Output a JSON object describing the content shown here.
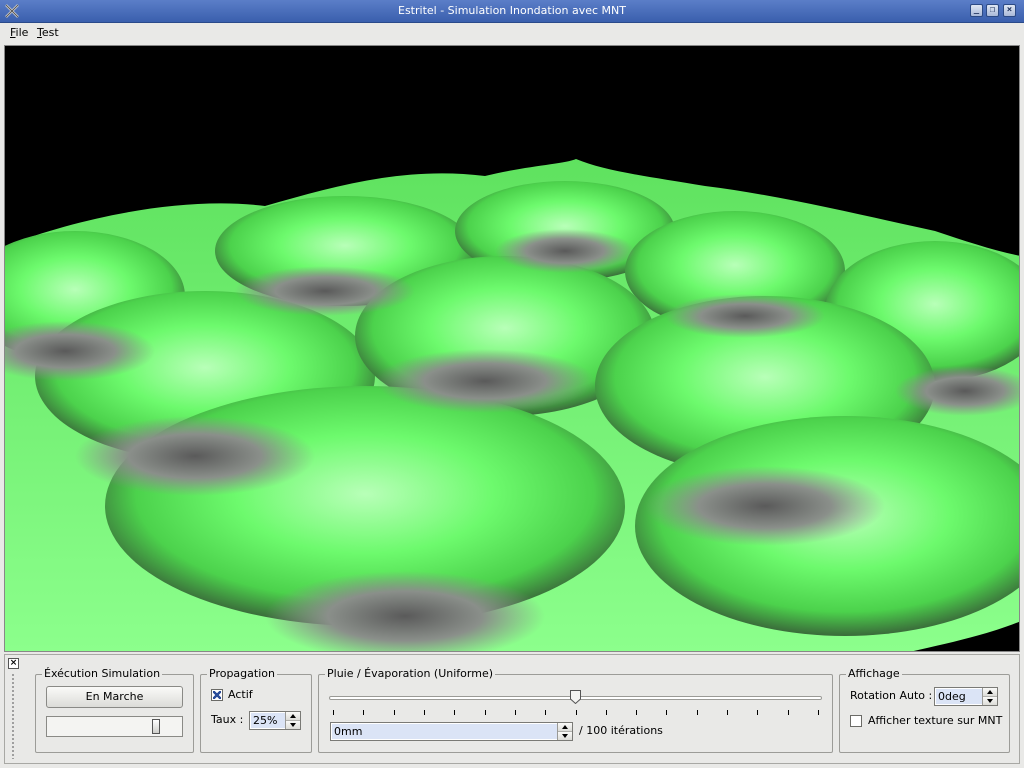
{
  "window": {
    "title": "Estritel - Simulation Inondation avec MNT",
    "buttons": [
      "minimize",
      "maximize",
      "close"
    ]
  },
  "menu": {
    "items": [
      "File",
      "Test"
    ]
  },
  "viewport": {
    "description_icon": "terrain-3d-view",
    "colors": {
      "background": "#000000",
      "terrain_light": "#7dff7d",
      "terrain_shadow": "#6e6e6e"
    }
  },
  "dock": {
    "execution": {
      "title": "Éxécution Simulation",
      "run_button": "En Marche",
      "slider_value": 0.83
    },
    "propagation": {
      "title": "Propagation",
      "active_label": "Actif",
      "active_checked": true,
      "rate_label": "Taux :",
      "rate_value": "25%"
    },
    "rain": {
      "title": "Pluie / Évaporation (Uniforme)",
      "slider_value": 0.5,
      "tick_count": 17,
      "amount_value": "0mm",
      "iterations_label": "/ 100 itérations"
    },
    "display": {
      "title": "Affichage",
      "rotation_label": "Rotation Auto :",
      "rotation_value": "0deg",
      "texture_label": "Afficher texture sur MNT",
      "texture_checked": false
    }
  }
}
